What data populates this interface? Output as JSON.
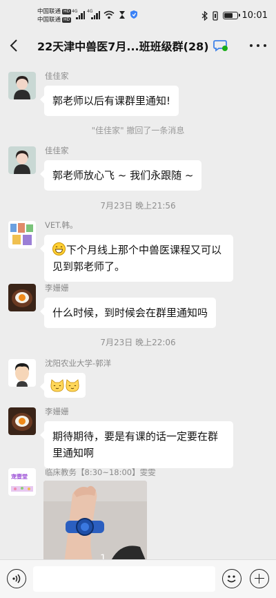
{
  "status_bar": {
    "carrier_1": "中国联通",
    "carrier_2": "中国联通",
    "hd_tag": "HD",
    "network_tag": "4G",
    "time": "10:01",
    "battery_level": 0.75,
    "icons": [
      "signal-icon",
      "wifi-icon",
      "hourglass-icon",
      "shield-icon",
      "bluetooth-icon",
      "vibrate-icon",
      "battery-icon"
    ]
  },
  "header": {
    "title": "22天津中兽医7月...班班级群(28)",
    "icons": [
      "back-icon",
      "chat-badge-icon",
      "more-icon"
    ]
  },
  "messages": [
    {
      "sender": "佳佳家",
      "text": "郭老师以后有课群里通知!"
    },
    {
      "system": "\"佳佳家\" 撤回了一条消息"
    },
    {
      "sender": "佳佳家",
      "text": "郭老师放心飞 ~ 我们永跟随 ~"
    },
    {
      "timestamp": "7月23日 晚上21:56"
    },
    {
      "sender": "VET.韩。",
      "text": "下个月线上那个中兽医课程又可以见到郭老师了。",
      "emoji": "grinning-face-emoji"
    },
    {
      "sender": "李姗姗",
      "text": "什么时候，到时候会在群里通知吗"
    },
    {
      "timestamp": "7月23日 晚上22:06"
    },
    {
      "sender": "沈阳农业大学-郭洋",
      "sticker": "cat-emoji-pair"
    },
    {
      "sender": "李姗姗",
      "text": "期待期待，要是有课的话一定要在群里通知啊"
    },
    {
      "sender": "临床教务【8:30~18:00】雯雯",
      "image": "photo-wrist-watch"
    }
  ],
  "avatar_logo_text": "宠壹堂",
  "input_bar": {
    "icons": [
      "voice-icon",
      "emoji-icon",
      "plus-icon"
    ],
    "placeholder": ""
  },
  "colors": {
    "background": "#ededed",
    "bubble": "#ffffff",
    "chat_badge": "#1aad19"
  }
}
